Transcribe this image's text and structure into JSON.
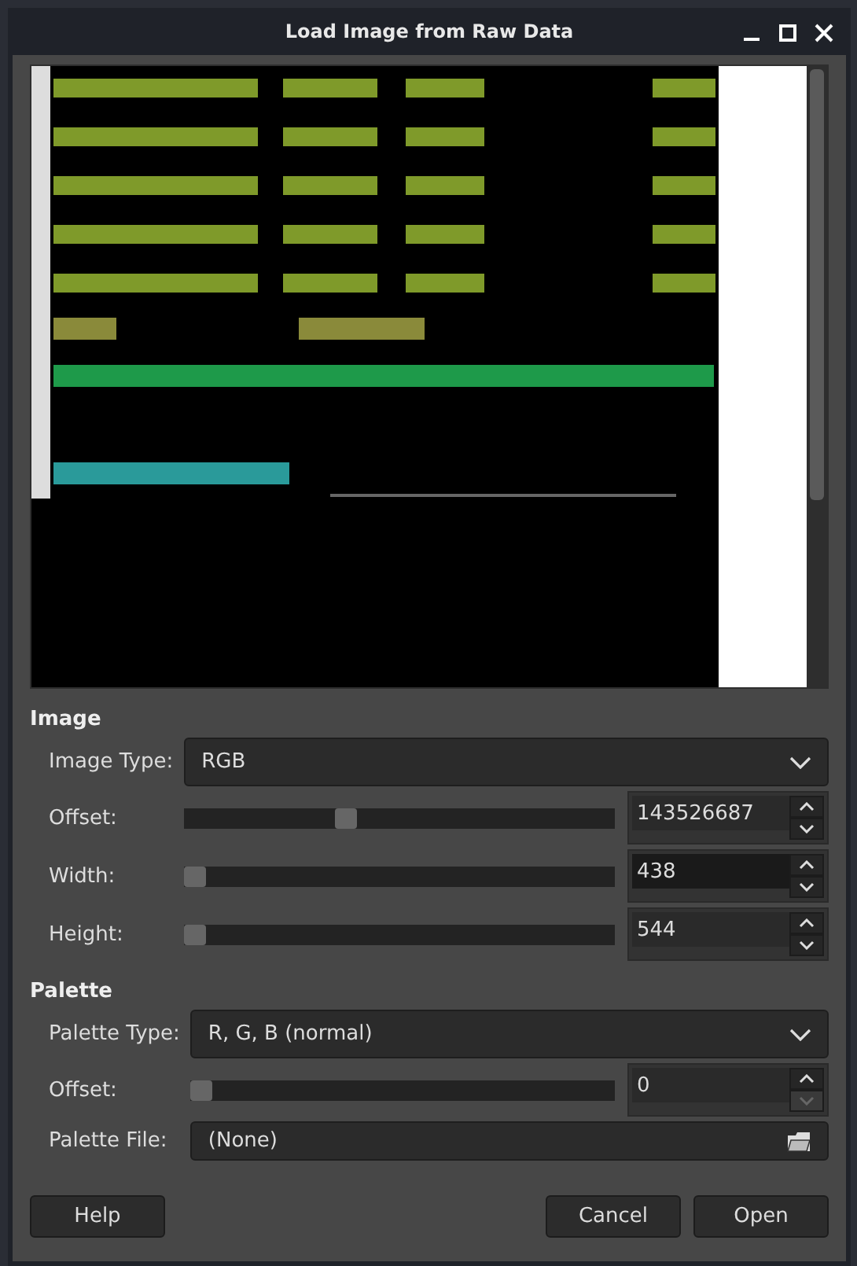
{
  "window": {
    "title": "Load Image from Raw Data"
  },
  "image_section": {
    "heading": "Image",
    "image_type": {
      "label": "Image Type:",
      "value": "RGB"
    },
    "spins": [
      {
        "label": "Offset:",
        "value": "143526687",
        "level": 0.37,
        "focused": false
      },
      {
        "label": "Width:",
        "value": "438",
        "level": 0.0,
        "focused": true
      },
      {
        "label": "Height:",
        "value": "544",
        "level": 0.0,
        "focused": false
      }
    ]
  },
  "palette_section": {
    "heading": "Palette",
    "palette_type": {
      "label": "Palette Type:",
      "value": "R, G, B (normal)"
    },
    "offset": {
      "label": "Offset:",
      "value": "0",
      "level": 0.0,
      "down_disabled": true
    },
    "palette_file": {
      "label": "Palette File:",
      "value": "(None)"
    }
  },
  "buttons": [
    {
      "label": "Help",
      "kind": "left"
    },
    {
      "label": "Cancel",
      "kind": "right"
    },
    {
      "label": "Open",
      "kind": "right"
    }
  ]
}
